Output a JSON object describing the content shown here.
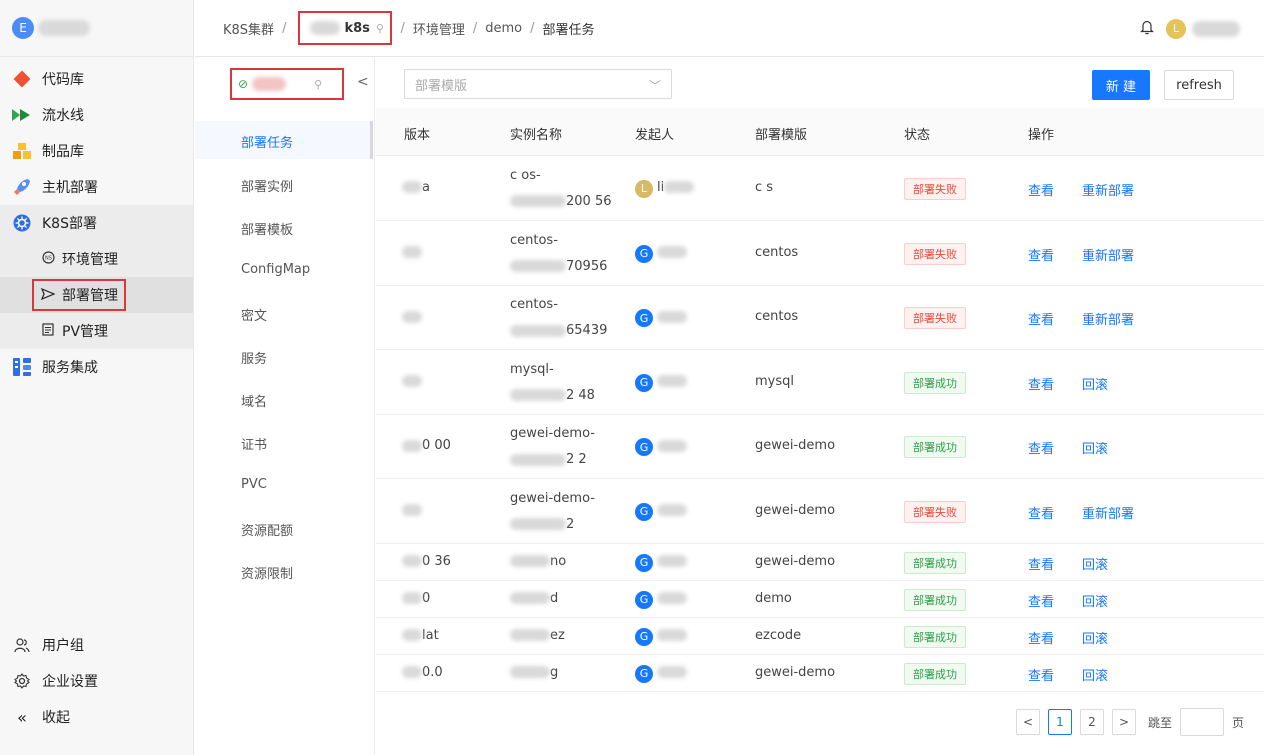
{
  "sidebar": {
    "org_initial": "E",
    "items": [
      {
        "label": "代码库",
        "icon": "git-icon"
      },
      {
        "label": "流水线",
        "icon": "pipeline-icon"
      },
      {
        "label": "制品库",
        "icon": "artifact-icon"
      },
      {
        "label": "主机部署",
        "icon": "rocket-icon"
      },
      {
        "label": "K8S部署",
        "icon": "kubernetes-icon"
      }
    ],
    "sub_items": [
      {
        "label": "环境管理",
        "icon": "ns-icon"
      },
      {
        "label": "部署管理",
        "icon": "send-icon"
      },
      {
        "label": "PV管理",
        "icon": "doc-icon"
      }
    ],
    "service_label": "服务集成",
    "bottom": [
      {
        "label": "用户组",
        "icon": "users-icon"
      },
      {
        "label": "企业设置",
        "icon": "gear-icon"
      },
      {
        "label": "收起",
        "icon": "collapse-icon"
      }
    ]
  },
  "header": {
    "crumb_root": "K8S集群",
    "crumb_cluster": "k8s",
    "crumb_env": "环境管理",
    "crumb_ns": "demo",
    "crumb_current": "部署任务",
    "sep": "/",
    "user_initial": "L"
  },
  "submenu": {
    "collapse": "<",
    "items": [
      "部署任务",
      "部署实例",
      "部署模板",
      "ConfigMap",
      "密文",
      "服务",
      "域名",
      "证书",
      "PVC",
      "资源配额",
      "资源限制"
    ]
  },
  "toolbar": {
    "template_placeholder": "部署模版",
    "new_label": "新 建",
    "refresh_label": "refresh"
  },
  "table": {
    "headers": [
      "版本",
      "实例名称",
      "发起人",
      "部署模版",
      "状态",
      "操作"
    ],
    "rows": [
      {
        "version": "a",
        "name1": "c    os-",
        "name2": "200        56",
        "initiator": "li",
        "init_av": "L",
        "template": "c      s",
        "status": "部署失败",
        "ok": false,
        "view": "查看",
        "action": "重新部署"
      },
      {
        "version": "",
        "name1": "centos-",
        "name2": "70956",
        "initiator": "",
        "init_av": "G",
        "template": "centos",
        "status": "部署失败",
        "ok": false,
        "view": "查看",
        "action": "重新部署"
      },
      {
        "version": "",
        "name1": "centos-",
        "name2": "65439",
        "initiator": "",
        "init_av": "G",
        "template": "centos",
        "status": "部署失败",
        "ok": false,
        "view": "查看",
        "action": "重新部署"
      },
      {
        "version": "",
        "name1": "mysql-",
        "name2": "2          48",
        "initiator": "",
        "init_av": "G",
        "template": "mysql",
        "status": "部署成功",
        "ok": true,
        "view": "查看",
        "action": "回滚"
      },
      {
        "version": "0       00",
        "name1": "gewei-demo-",
        "name2": "2          2",
        "initiator": "",
        "init_av": "G",
        "template": "gewei-demo",
        "status": "部署成功",
        "ok": true,
        "view": "查看",
        "action": "回滚"
      },
      {
        "version": "",
        "name1": "gewei-demo-",
        "name2": "2",
        "initiator": "",
        "init_av": "G",
        "template": "gewei-demo",
        "status": "部署失败",
        "ok": false,
        "view": "查看",
        "action": "重新部署"
      },
      {
        "version": "0     36",
        "name1": "no",
        "name2": "",
        "initiator": "",
        "init_av": "G",
        "template": "gewei-demo",
        "status": "部署成功",
        "ok": true,
        "view": "查看",
        "action": "回滚"
      },
      {
        "version": "0",
        "name1": "d",
        "name2": "",
        "initiator": "",
        "init_av": "G",
        "template": "demo",
        "status": "部署成功",
        "ok": true,
        "view": "查看",
        "action": "回滚"
      },
      {
        "version": "lat",
        "name1": "ez",
        "name2": "",
        "initiator": "",
        "init_av": "G",
        "template": "ezcode",
        "status": "部署成功",
        "ok": true,
        "view": "查看",
        "action": "回滚"
      },
      {
        "version": "0.0",
        "name1": "g",
        "name2": "",
        "initiator": "",
        "init_av": "G",
        "template": "gewei-demo",
        "status": "部署成功",
        "ok": true,
        "view": "查看",
        "action": "回滚"
      }
    ]
  },
  "pagination": {
    "prev": "<",
    "pages": [
      "1",
      "2"
    ],
    "next": ">",
    "jump_label": "跳至",
    "page_suffix": "页"
  }
}
